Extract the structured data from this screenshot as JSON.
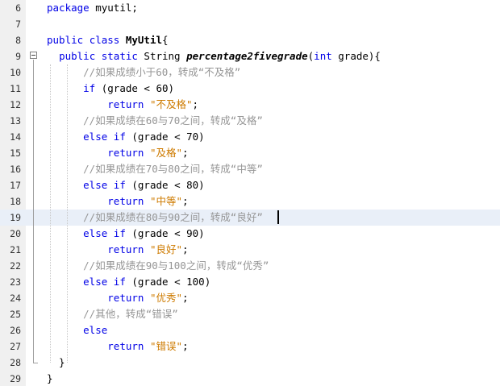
{
  "editor": {
    "lines": [
      {
        "number": "6",
        "segments": [
          {
            "t": "package",
            "c": "kw"
          },
          {
            "t": " myutil;",
            "c": ""
          }
        ]
      },
      {
        "number": "7",
        "segments": []
      },
      {
        "number": "8",
        "segments": [
          {
            "t": "public",
            "c": "kw"
          },
          {
            "t": " ",
            "c": ""
          },
          {
            "t": "class",
            "c": "kw"
          },
          {
            "t": " ",
            "c": ""
          },
          {
            "t": "MyUtil",
            "c": "bold"
          },
          {
            "t": "{",
            "c": ""
          }
        ]
      },
      {
        "number": "9",
        "segments": [
          {
            "t": "  ",
            "c": ""
          },
          {
            "t": "public",
            "c": "kw"
          },
          {
            "t": " ",
            "c": ""
          },
          {
            "t": "static",
            "c": "kw"
          },
          {
            "t": " String ",
            "c": ""
          },
          {
            "t": "percentage2fivegrade",
            "c": "bold-it"
          },
          {
            "t": "(",
            "c": ""
          },
          {
            "t": "int",
            "c": "kw"
          },
          {
            "t": " grade){",
            "c": ""
          }
        ]
      },
      {
        "number": "10",
        "segments": [
          {
            "t": "      ",
            "c": ""
          },
          {
            "t": "//如果成绩小于60，转成“不及格”",
            "c": "cm"
          }
        ]
      },
      {
        "number": "11",
        "segments": [
          {
            "t": "      ",
            "c": ""
          },
          {
            "t": "if",
            "c": "kw"
          },
          {
            "t": " (grade < 60)",
            "c": ""
          }
        ]
      },
      {
        "number": "12",
        "segments": [
          {
            "t": "          ",
            "c": ""
          },
          {
            "t": "return",
            "c": "kw"
          },
          {
            "t": " ",
            "c": ""
          },
          {
            "t": "\"不及格\"",
            "c": "str"
          },
          {
            "t": ";",
            "c": ""
          }
        ]
      },
      {
        "number": "13",
        "segments": [
          {
            "t": "      ",
            "c": ""
          },
          {
            "t": "//如果成绩在60与70之间，转成“及格”",
            "c": "cm"
          }
        ]
      },
      {
        "number": "14",
        "segments": [
          {
            "t": "      ",
            "c": ""
          },
          {
            "t": "else",
            "c": "kw"
          },
          {
            "t": " ",
            "c": ""
          },
          {
            "t": "if",
            "c": "kw"
          },
          {
            "t": " (grade < 70)",
            "c": ""
          }
        ]
      },
      {
        "number": "15",
        "segments": [
          {
            "t": "          ",
            "c": ""
          },
          {
            "t": "return",
            "c": "kw"
          },
          {
            "t": " ",
            "c": ""
          },
          {
            "t": "\"及格\"",
            "c": "str"
          },
          {
            "t": ";",
            "c": ""
          }
        ]
      },
      {
        "number": "16",
        "segments": [
          {
            "t": "      ",
            "c": ""
          },
          {
            "t": "//如果成绩在70与80之间，转成“中等”",
            "c": "cm"
          }
        ]
      },
      {
        "number": "17",
        "segments": [
          {
            "t": "      ",
            "c": ""
          },
          {
            "t": "else",
            "c": "kw"
          },
          {
            "t": " ",
            "c": ""
          },
          {
            "t": "if",
            "c": "kw"
          },
          {
            "t": " (grade < 80)",
            "c": ""
          }
        ]
      },
      {
        "number": "18",
        "segments": [
          {
            "t": "          ",
            "c": ""
          },
          {
            "t": "return",
            "c": "kw"
          },
          {
            "t": " ",
            "c": ""
          },
          {
            "t": "\"中等\"",
            "c": "str"
          },
          {
            "t": ";",
            "c": ""
          }
        ]
      },
      {
        "number": "19",
        "current": true,
        "segments": [
          {
            "t": "      ",
            "c": ""
          },
          {
            "t": "//如果成绩在80与90之间，转成“良好”",
            "c": "cm"
          }
        ]
      },
      {
        "number": "20",
        "segments": [
          {
            "t": "      ",
            "c": ""
          },
          {
            "t": "else",
            "c": "kw"
          },
          {
            "t": " ",
            "c": ""
          },
          {
            "t": "if",
            "c": "kw"
          },
          {
            "t": " (grade < 90)",
            "c": ""
          }
        ]
      },
      {
        "number": "21",
        "segments": [
          {
            "t": "          ",
            "c": ""
          },
          {
            "t": "return",
            "c": "kw"
          },
          {
            "t": " ",
            "c": ""
          },
          {
            "t": "\"良好\"",
            "c": "str"
          },
          {
            "t": ";",
            "c": ""
          }
        ]
      },
      {
        "number": "22",
        "segments": [
          {
            "t": "      ",
            "c": ""
          },
          {
            "t": "//如果成绩在90与100之间，转成“优秀”",
            "c": "cm"
          }
        ]
      },
      {
        "number": "23",
        "segments": [
          {
            "t": "      ",
            "c": ""
          },
          {
            "t": "else",
            "c": "kw"
          },
          {
            "t": " ",
            "c": ""
          },
          {
            "t": "if",
            "c": "kw"
          },
          {
            "t": " (grade < 100)",
            "c": ""
          }
        ]
      },
      {
        "number": "24",
        "segments": [
          {
            "t": "          ",
            "c": ""
          },
          {
            "t": "return",
            "c": "kw"
          },
          {
            "t": " ",
            "c": ""
          },
          {
            "t": "\"优秀\"",
            "c": "str"
          },
          {
            "t": ";",
            "c": ""
          }
        ]
      },
      {
        "number": "25",
        "segments": [
          {
            "t": "      ",
            "c": ""
          },
          {
            "t": "//其他，转成“错误”",
            "c": "cm"
          }
        ]
      },
      {
        "number": "26",
        "segments": [
          {
            "t": "      ",
            "c": ""
          },
          {
            "t": "else",
            "c": "kw"
          }
        ]
      },
      {
        "number": "27",
        "segments": [
          {
            "t": "          ",
            "c": ""
          },
          {
            "t": "return",
            "c": "kw"
          },
          {
            "t": " ",
            "c": ""
          },
          {
            "t": "\"错误\"",
            "c": "str"
          },
          {
            "t": ";",
            "c": ""
          }
        ]
      },
      {
        "number": "28",
        "segments": [
          {
            "t": "  }",
            "c": ""
          }
        ]
      },
      {
        "number": "29",
        "segments": [
          {
            "t": "}",
            "c": ""
          }
        ]
      }
    ],
    "colors": {
      "keyword": "#0000e6",
      "comment": "#969696",
      "string": "#ce7b00",
      "current_line": "#e9eff8",
      "gutter": "#f0f0f0"
    }
  }
}
